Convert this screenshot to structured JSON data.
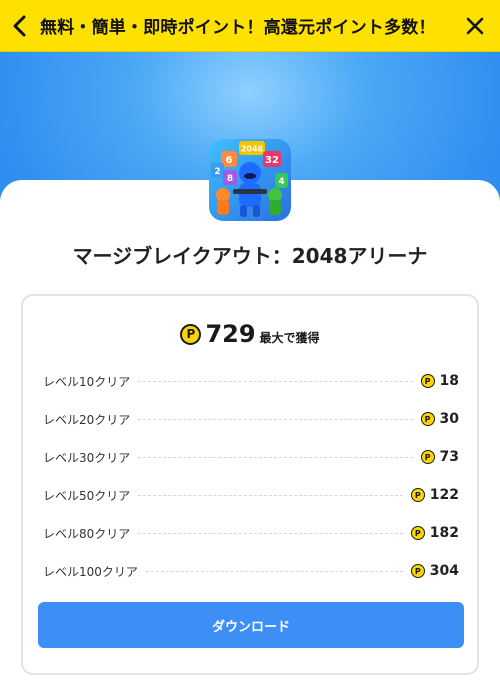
{
  "header": {
    "title": "無料・簡単・即時ポイント！高還元ポイント多数！",
    "back_icon": "chevron-left-icon",
    "close_icon": "close-icon",
    "background": "#ffe100"
  },
  "app": {
    "icon": "app-icon",
    "icon_tiles": [
      "2048",
      "6",
      "32",
      "2",
      "8",
      "4"
    ],
    "title": "マージブレイクアウト：2048アリーナ"
  },
  "rewards": {
    "max_value": "729",
    "max_suffix": "最大で獲得",
    "coin_symbol": "P",
    "coin_color": "#ffd400",
    "items": [
      {
        "label": "レベル10クリア",
        "points": "18"
      },
      {
        "label": "レベル20クリア",
        "points": "30"
      },
      {
        "label": "レベル30クリア",
        "points": "73"
      },
      {
        "label": "レベル50クリア",
        "points": "122"
      },
      {
        "label": "レベル80クリア",
        "points": "182"
      },
      {
        "label": "レベル100クリア",
        "points": "304"
      }
    ]
  },
  "download": {
    "label": "ダウンロード",
    "color": "#3d8ff5"
  }
}
